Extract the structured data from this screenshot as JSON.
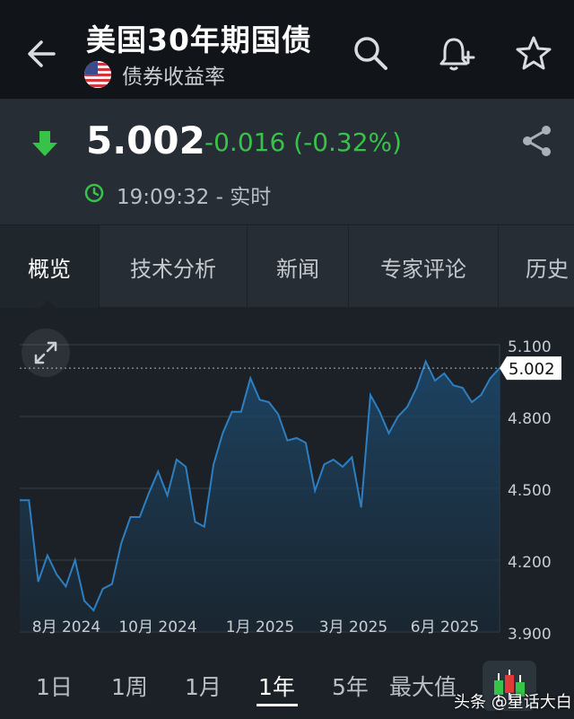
{
  "header": {
    "title": "美国30年期国债",
    "subtitle": "债券收益率",
    "icons": [
      "back-arrow-icon",
      "search-icon",
      "bell-plus-icon",
      "star-icon"
    ]
  },
  "quote": {
    "price": "5.002",
    "change": "-0.016 (-0.32%)",
    "time": "19:09:32 - 实时",
    "direction": "down",
    "down_color": "#37c34a"
  },
  "tabs": [
    {
      "label": "概览"
    },
    {
      "label": "技术分析"
    },
    {
      "label": "新闻"
    },
    {
      "label": "专家评论"
    },
    {
      "label": "历史"
    }
  ],
  "ranges": [
    {
      "label": "1日"
    },
    {
      "label": "1周"
    },
    {
      "label": "1月"
    },
    {
      "label": "1年"
    },
    {
      "label": "5年"
    },
    {
      "label": "最大值"
    }
  ],
  "active_range": "1年",
  "watermark": "头条 @星话大白",
  "chart_data": {
    "type": "area",
    "line_color": "#2d7fc1",
    "ylim": [
      3.9,
      5.1
    ],
    "ytick_labels": [
      "5.100",
      "4.800",
      "4.500",
      "4.200",
      "3.900"
    ],
    "yticks": [
      5.1,
      4.8,
      4.5,
      4.2,
      3.9
    ],
    "xtick_labels": [
      "8月 2024",
      "10月 2024",
      "1月 2025",
      "3月 2025",
      "6月 2025"
    ],
    "current_label": "5.002",
    "current_value": 5.002,
    "values": [
      4.45,
      4.45,
      4.11,
      4.22,
      4.14,
      4.09,
      4.2,
      4.03,
      3.99,
      4.08,
      4.1,
      4.27,
      4.38,
      4.38,
      4.48,
      4.57,
      4.47,
      4.62,
      4.59,
      4.36,
      4.34,
      4.6,
      4.73,
      4.82,
      4.82,
      4.96,
      4.87,
      4.86,
      4.81,
      4.7,
      4.71,
      4.69,
      4.49,
      4.6,
      4.62,
      4.59,
      4.63,
      4.42,
      4.89,
      4.82,
      4.73,
      4.8,
      4.84,
      4.92,
      5.03,
      4.95,
      4.98,
      4.93,
      4.92,
      4.86,
      4.89,
      4.96,
      5.002
    ]
  }
}
